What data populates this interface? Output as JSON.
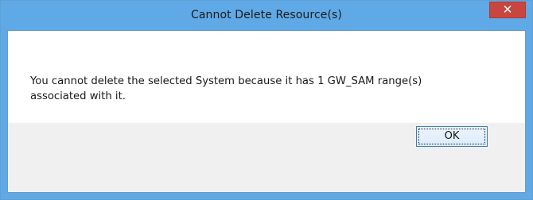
{
  "dialog": {
    "title": "Cannot Delete Resource(s)",
    "message_line1": "You cannot delete the selected System because it has 1 GW_SAM range(s)",
    "message_line2": "associated with it.",
    "ok_label": "OK",
    "close_glyph": "✕",
    "close_icon": "close-icon"
  },
  "colors": {
    "titlebar": "#5fa9e6",
    "close_button": "#c7463f",
    "message_background": "#ffffff",
    "button_area_background": "#f0f0f0"
  }
}
